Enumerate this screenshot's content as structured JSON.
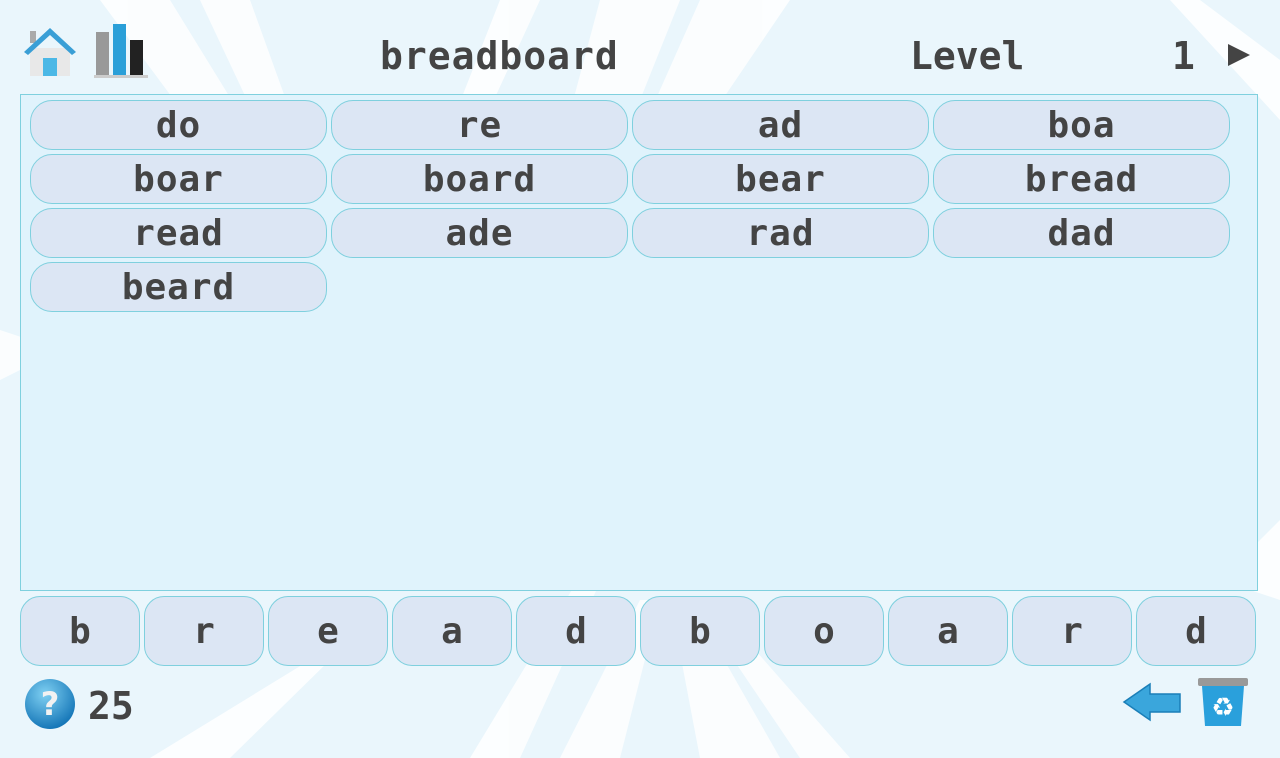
{
  "header": {
    "puzzle_word": "breadboard",
    "level_label": "Level",
    "level_number": "1",
    "icons": [
      "home-icon",
      "stats-chart-icon",
      "next-arrow-icon"
    ]
  },
  "found_words": [
    {
      "text": "do"
    },
    {
      "text": "re"
    },
    {
      "text": "ad"
    },
    {
      "text": "boa"
    },
    {
      "text": "boar"
    },
    {
      "text": "board"
    },
    {
      "text": "bear"
    },
    {
      "text": "bread"
    },
    {
      "text": "read"
    },
    {
      "text": "ade"
    },
    {
      "text": "rad"
    },
    {
      "text": "dad"
    },
    {
      "text": "beard"
    }
  ],
  "letters": [
    {
      "char": "b"
    },
    {
      "char": "r"
    },
    {
      "char": "e"
    },
    {
      "char": "a"
    },
    {
      "char": "d"
    },
    {
      "char": "b"
    },
    {
      "char": "o"
    },
    {
      "char": "a"
    },
    {
      "char": "r"
    },
    {
      "char": "d"
    }
  ],
  "footer": {
    "hint_count": "25",
    "icons": [
      "help-icon",
      "back-arrow-icon",
      "recycle-bin-icon"
    ]
  },
  "colors": {
    "background": "#eaf6fc",
    "panel": "#e0f3fc",
    "tile": "#dce6f4",
    "tile_border": "#7fd0de",
    "text": "#444444",
    "accent_blue": "#2a9fd8"
  }
}
